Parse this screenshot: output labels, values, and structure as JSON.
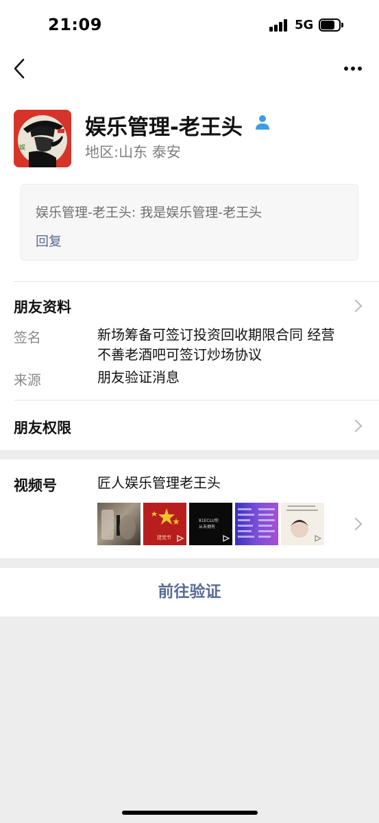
{
  "status_bar": {
    "time": "21:09",
    "network": "5G"
  },
  "nav": {
    "back_icon": "chevron-left-icon",
    "more_icon": "more-horizontal-icon"
  },
  "profile": {
    "name": "娱乐管理-老王头",
    "name_icon": "contact-person-icon",
    "region": "地区:山东 泰安",
    "avatar_icon": "avatar-image",
    "message": "娱乐管理-老王头: 我是娱乐管理-老王头",
    "reply_label": "回复"
  },
  "info": {
    "friend_profile_title": "朋友资料",
    "signature_label": "签名",
    "signature_line1": "新场筹备可签订投资回收期限合同 经营",
    "signature_line2": "不善老酒吧可签订炒场协议",
    "source_label": "来源",
    "source_value": "朋友验证消息",
    "permissions_title": "朋友权限"
  },
  "channel": {
    "label": "视频号",
    "name": "匠人娱乐管理老王头",
    "thumbnail_captions": [
      "",
      "建党节",
      "81ECLU你\n从未拥有",
      "",
      ""
    ]
  },
  "verify": {
    "label": "前往验证"
  },
  "colors": {
    "link": "#576b95",
    "background": "#ededed",
    "card": "#ffffff",
    "avatar_red": "#d6342b"
  }
}
